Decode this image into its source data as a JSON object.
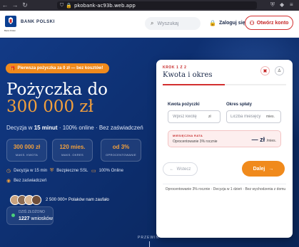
{
  "browser": {
    "url": "pkobank-ac93b.web.app"
  },
  "header": {
    "brand": "BANK POLSKI",
    "logo_sub": "Bank Polski",
    "search_placeholder": "Wyszukaj",
    "login_label": "Zaloguj się",
    "open_account_label": "Otwórz konto"
  },
  "hero": {
    "promo": "Pierwsza pożyczka za 0 zł — bez kosztów!",
    "title": "Pożyczka do",
    "amount": "300 000 zł",
    "sub_prefix": "Decyzja w ",
    "sub_bold": "15 minut",
    "sub_rest": " · 100% online · Bez zaświadczeń",
    "stats": [
      {
        "value": "300 000 zł",
        "label": "MAKS. KWOTA"
      },
      {
        "value": "120 mies.",
        "label": "MAKS. OKRES"
      },
      {
        "value": "od 3%",
        "label": "OPROCENTOWANIE"
      }
    ],
    "features": [
      "Decyzja w 15 min",
      "Bezpieczne SSL",
      "100% Online",
      "Bez zaświadczeń"
    ],
    "social_proof": "2 500 000+ Polaków nam zaufało",
    "today_label": "DZIŚ ZŁOŻONO",
    "today_value": "1227",
    "today_unit": " wniosków",
    "scroll_hint": "PRZEWIŃ"
  },
  "form": {
    "step_label": "KROK 1 Z 2",
    "step_title": "Kwota i okres",
    "progress": 0.5,
    "amount_label": "Kwota pożyczki",
    "amount_placeholder": "Wpisz kwotę",
    "amount_suffix": "zł",
    "period_label": "Okres spłaty",
    "period_placeholder": "Liczba miesięcy",
    "period_suffix": "mies.",
    "rate_label": "MIESIĘCZNA RATA",
    "rate_desc": "Oprocentowanie 3% rocznie",
    "rate_value": "— zł",
    "rate_unit": "/mies.",
    "back_label": "Wstecz",
    "next_label": "Dalej",
    "footnote": "Oprocentowanie 3% rocznie · Decyzja w 1 dzień · Bez wychodzenia z domu"
  },
  "colors": {
    "accent_orange": "#f08a1c",
    "brand_red": "#d32f2f",
    "hero_blue": "#0e2f72"
  }
}
